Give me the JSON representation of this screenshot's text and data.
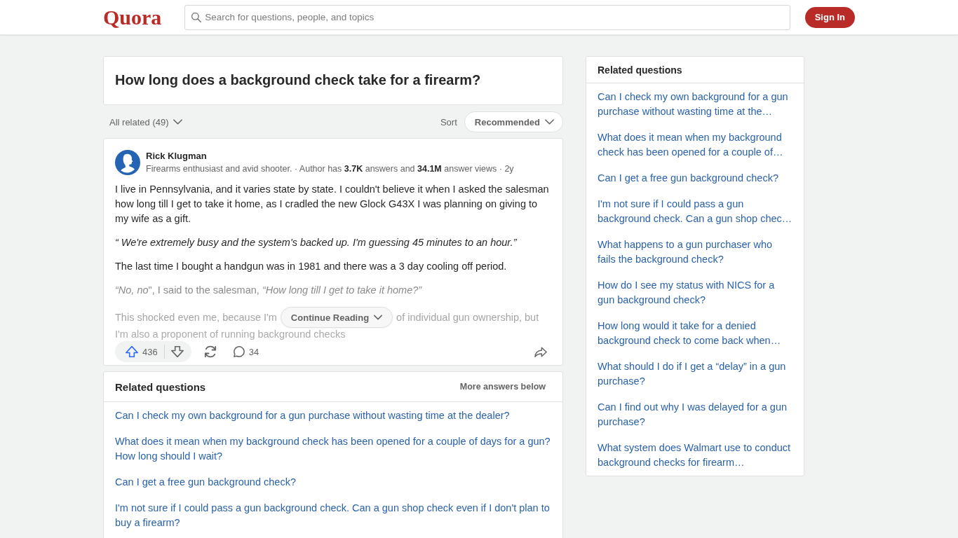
{
  "header": {
    "logo": "Quora",
    "search": {
      "placeholder": "Search for questions, people, and topics"
    },
    "sign_in_button": "Sign In"
  },
  "question": {
    "title": "How long does a background check take for a firearm?"
  },
  "filters": {
    "all_related": "All related (49)",
    "sort_label": "Sort",
    "sort_value": "Recommended"
  },
  "answer": {
    "author": "Rick Klugman",
    "credential": "Firearms enthusiast and avid shooter. · Author has **3.7K** answers and **34.1M** answer views · 2y",
    "paragraphs": [
      {
        "kind": "plain",
        "text": "I live in Pennsylvania, and it varies state by state. I couldn't believe it when I asked the salesman how long till I get to take it home, as I cradled the new Glock G43X I was planning on giving to my wife as a gift."
      },
      {
        "kind": "quote",
        "text": "“ We're extremely busy and the system's backed up. I'm guessing 45 minutes to an hour.”"
      },
      {
        "kind": "plain",
        "text": "The last time I bought a handgun was in 1981 and there was a 3 day cooling off period."
      },
      {
        "kind": "dimmed",
        "text": "*“No, no*\", I said to the salesman, *“How long till I get to take it home?”*"
      }
    ],
    "fade": {
      "before": "This shocked even me, because I'm",
      "after": "of individual gun ownership, but",
      "last_line": "I'm also a proponent of running background checks"
    },
    "continue_button": "Continue Reading",
    "upvotes": "436",
    "comments": "34"
  },
  "related_main": {
    "title": "Related questions",
    "more_label": "More answers below",
    "items": [
      "Can I check my own background for a gun purchase without wasting time at the dealer?",
      "What does it mean when my background check has been opened for a couple of days for a gun? How long should I wait?",
      "Can I get a free gun background check?",
      "I'm not sure if I could pass a gun background check. Can a gun shop check even if I don't plan to buy a firearm?"
    ]
  },
  "related_sidebar": {
    "title": "Related questions",
    "items": [
      "Can I check my own background for a gun purchase without wasting time at the…",
      "What does it mean when my background check has been opened for a couple of…",
      "Can I get a free gun background check?",
      "I'm not sure if I could pass a gun background check. Can a gun shop chec…",
      "What happens to a gun purchaser who fails the background check?",
      "How do I see my status with NICS for a gun background check?",
      "How long would it take for a denied background check to come back when…",
      "What should I do if I get a “delay” in a gun purchase?",
      "Can I find out why I was delayed for a gun purchase?",
      "What system does Walmart use to conduct background checks for firearm…"
    ]
  }
}
